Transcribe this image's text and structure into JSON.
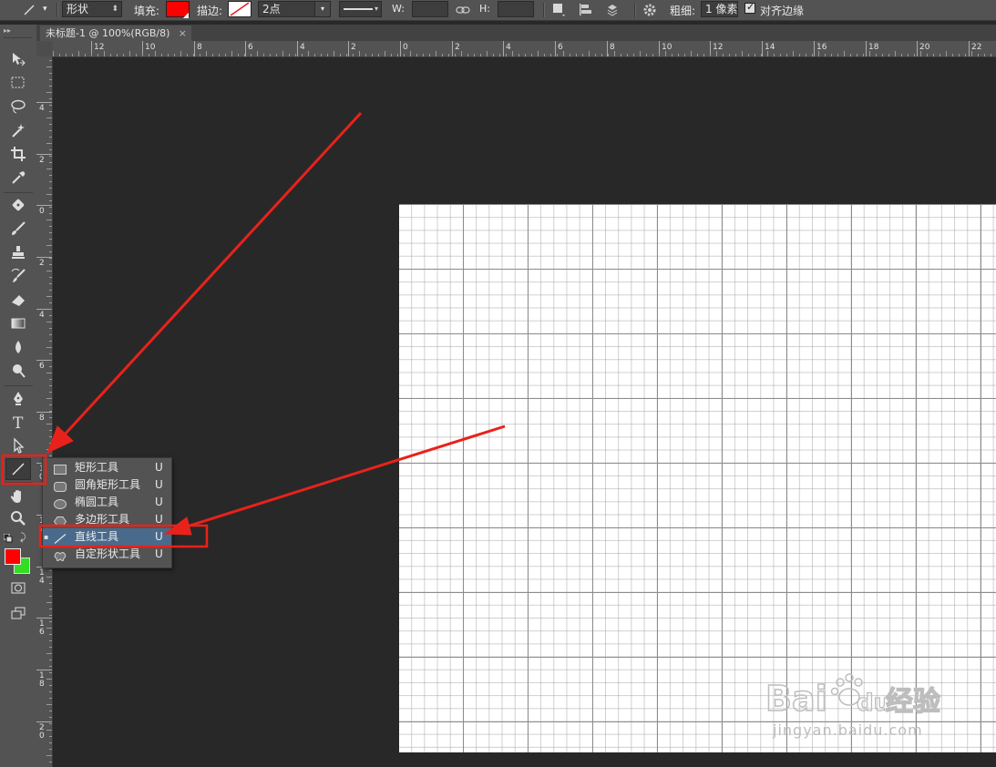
{
  "options_bar": {
    "shape_mode": "形状",
    "fill_label": "填充:",
    "fill_color": "#ff0000",
    "stroke_label": "描边:",
    "stroke_width": "2点",
    "w_label": "W:",
    "h_label": "H:",
    "weight_label": "粗细:",
    "weight_value": "1 像素",
    "align_edges_label": "对齐边缘",
    "align_edges_checked": true
  },
  "document_tab": {
    "title": "未标题-1 @ 100%(RGB/8)",
    "close": "×"
  },
  "h_ruler_labels": [
    "12",
    "10",
    "8",
    "6",
    "4",
    "2",
    "0",
    "2",
    "4",
    "6",
    "8",
    "10",
    "12",
    "14",
    "16",
    "18",
    "20",
    "22"
  ],
  "v_ruler_labels": [
    "4",
    "2",
    "0",
    "2",
    "4",
    "6",
    "8",
    "1\n0",
    "1\n2",
    "1\n4",
    "1\n6",
    "1\n8",
    "2\n0"
  ],
  "toolbar": {
    "foreground_color": "#ff0000",
    "background_color": "#33dd22",
    "tools": [
      "move",
      "marquee",
      "lasso",
      "magic-wand",
      "crop",
      "eyedropper",
      "healing",
      "brush",
      "stamp",
      "history-brush",
      "eraser",
      "gradient",
      "blur",
      "dodge",
      "pen",
      "type",
      "path-select",
      "line",
      "hand",
      "zoom"
    ]
  },
  "flyout": {
    "items": [
      {
        "label": "矩形工具",
        "key": "U",
        "icon": "rect-icon",
        "selected": false
      },
      {
        "label": "圆角矩形工具",
        "key": "U",
        "icon": "rounded-rect-icon",
        "selected": false
      },
      {
        "label": "椭圆工具",
        "key": "U",
        "icon": "ellipse-icon",
        "selected": false
      },
      {
        "label": "多边形工具",
        "key": "U",
        "icon": "polygon-icon",
        "selected": false
      },
      {
        "label": "直线工具",
        "key": "U",
        "icon": "line-icon",
        "selected": true
      },
      {
        "label": "自定形状工具",
        "key": "U",
        "icon": "custom-shape-icon",
        "selected": false
      }
    ]
  },
  "watermark": {
    "brand": "Bai",
    "brand2": "du",
    "cn": "经验",
    "url": "jingyan.baidu.com"
  },
  "colors": {
    "annotation_red": "#e8221b",
    "panel": "#535353",
    "workspace": "#282828"
  }
}
